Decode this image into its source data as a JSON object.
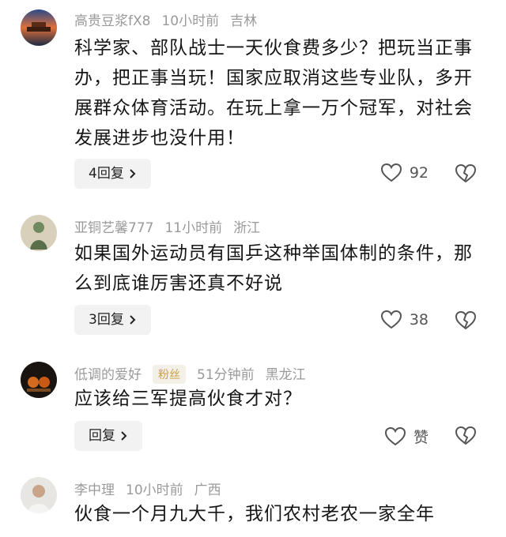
{
  "comments": [
    {
      "user": "高贵豆浆fX8",
      "time": "10小时前",
      "location": "吉林",
      "text": "科学家、部队战士一天伙食费多少？把玩当正事办，把正事当玩！国家应取消这些专业队，多开展群众体育活动。在玩上拿一万个冠军，对社会发展进步也没什用！",
      "replies": "4回复",
      "likes": "92"
    },
    {
      "user": "亚铜艺馨777",
      "time": "11小时前",
      "location": "浙江",
      "text": "如果国外运动员有国乒这种举国体制的条件，那么到底谁厉害还真不好说",
      "replies": "3回复",
      "likes": "38"
    },
    {
      "user": "低调的爱好",
      "badge": "粉丝",
      "time": "51分钟前",
      "location": "黑龙江",
      "text": "应该给三军提高伙食才对？",
      "replies": "回复",
      "likes": "赞"
    },
    {
      "user": "李中理",
      "time": "10小时前",
      "location": "广西",
      "text": "伙食一个月九大千，我们农村老农一家全年"
    }
  ]
}
